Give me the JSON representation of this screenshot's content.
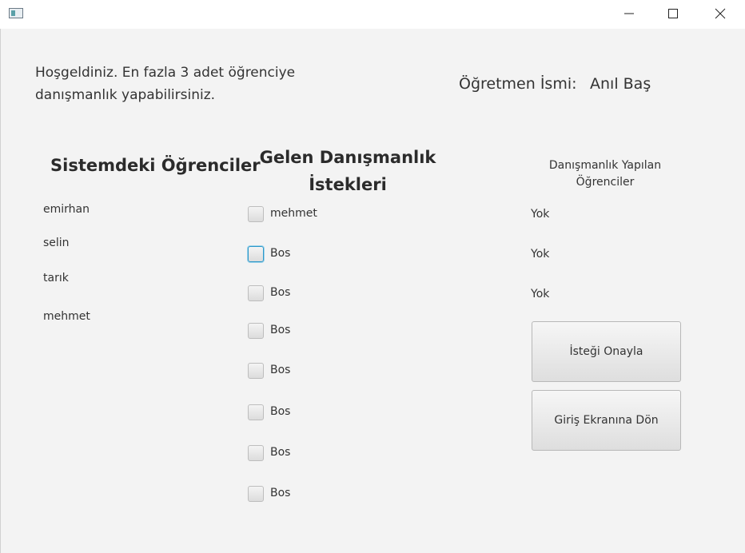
{
  "window": {
    "controls": {
      "minimize_icon": "minimize-icon",
      "maximize_icon": "maximize-icon",
      "close_icon": "close-icon"
    }
  },
  "header": {
    "welcome": "Hoşgeldiniz. En fazla 3 adet öğrenciye danışmanlık yapabilirsiniz.",
    "teacher_label": "Öğretmen İsmi:",
    "teacher_name": "Anıl Baş"
  },
  "students": {
    "title": "Sistemdeki Öğrenciler",
    "items": [
      "emirhan",
      "selin",
      "tarık",
      "mehmet"
    ]
  },
  "requests": {
    "title": "Gelen Danışmanlık İstekleri",
    "items": [
      {
        "label": "mehmet",
        "checked": false,
        "focused": false
      },
      {
        "label": "Bos",
        "checked": false,
        "focused": true
      },
      {
        "label": "Bos",
        "checked": false,
        "focused": false
      },
      {
        "label": "Bos",
        "checked": false,
        "focused": false
      },
      {
        "label": "Bos",
        "checked": false,
        "focused": false
      },
      {
        "label": "Bos",
        "checked": false,
        "focused": false
      },
      {
        "label": "Bos",
        "checked": false,
        "focused": false
      },
      {
        "label": "Bos",
        "checked": false,
        "focused": false
      }
    ]
  },
  "advised": {
    "title": "Danışmanlık Yapılan Öğrenciler",
    "items": [
      "Yok",
      "Yok",
      "Yok"
    ]
  },
  "buttons": {
    "approve": "İsteği Onayla",
    "back": "Giriş Ekranına Dön"
  },
  "colors": {
    "focus_accent": "#2b97c9",
    "background": "#f3f3f3"
  }
}
